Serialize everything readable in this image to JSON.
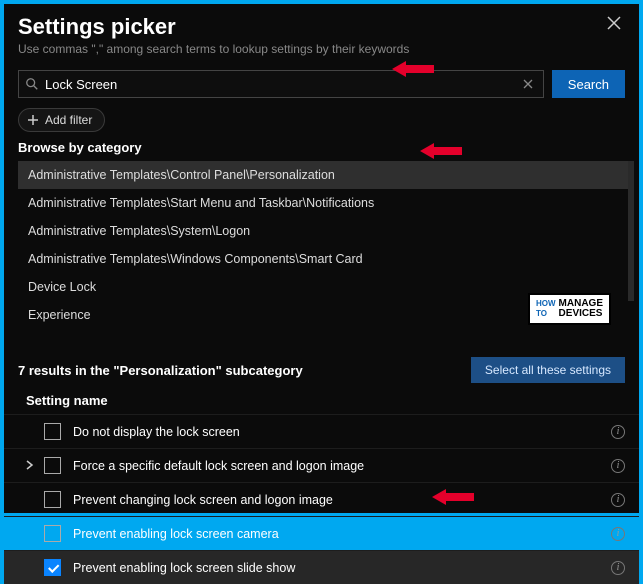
{
  "header": {
    "title": "Settings picker",
    "subtitle": "Use commas \",\" among search terms to lookup settings by their keywords"
  },
  "search": {
    "value": "Lock Screen",
    "button": "Search"
  },
  "filter": {
    "add": "Add filter"
  },
  "browse": {
    "label": "Browse by category",
    "items": [
      "Administrative Templates\\Control Panel\\Personalization",
      "Administrative Templates\\Start Menu and Taskbar\\Notifications",
      "Administrative Templates\\System\\Logon",
      "Administrative Templates\\Windows Components\\Smart Card",
      "Device Lock",
      "Experience"
    ],
    "selectedIndex": 0
  },
  "watermark": {
    "l1a": "HOW",
    "l1b": "MANAGE",
    "l2a": "TO",
    "l2b": "DEVICES"
  },
  "results": {
    "summary": "7 results in the \"Personalization\" subcategory",
    "selectAll": "Select all these settings",
    "columnHeader": "Setting name",
    "items": [
      {
        "label": "Do not display the lock screen",
        "checked": false,
        "expandable": false
      },
      {
        "label": "Force a specific default lock screen and logon image",
        "checked": false,
        "expandable": true
      },
      {
        "label": "Prevent changing lock screen and logon image",
        "checked": false,
        "expandable": false
      },
      {
        "label": "Prevent enabling lock screen camera",
        "checked": false,
        "expandable": false
      },
      {
        "label": "Prevent enabling lock screen slide show",
        "checked": true,
        "expandable": false
      }
    ]
  },
  "annotations": {
    "arrowColor": "#e4002b"
  }
}
